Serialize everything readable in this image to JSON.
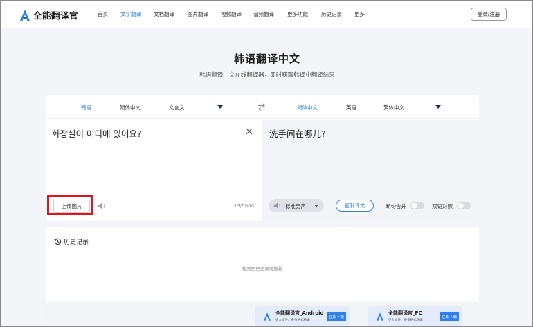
{
  "brand": {
    "name": "全能翻译官"
  },
  "nav": {
    "items": [
      {
        "label": "首页",
        "active": false
      },
      {
        "label": "文字翻译",
        "active": true
      },
      {
        "label": "文档翻译",
        "active": false
      },
      {
        "label": "图片翻译",
        "active": false
      },
      {
        "label": "视频翻译",
        "active": false
      },
      {
        "label": "音频翻译",
        "active": false
      },
      {
        "label": "更多功能",
        "active": false
      },
      {
        "label": "历史记录",
        "active": false
      },
      {
        "label": "更多",
        "active": false
      }
    ],
    "login_label": "登录/注册"
  },
  "hero": {
    "title": "韩语翻译中文",
    "subtitle": "韩语翻译中文在线翻译器，即时获取韩译中翻译结果"
  },
  "translator": {
    "source_langs": [
      "韩语",
      "简体中文",
      "文言文"
    ],
    "target_langs": [
      "简体中文",
      "英语",
      "繁体中文"
    ],
    "source_text": "화장실이 어디에 있어요?",
    "target_text": "洗手间在哪儿?",
    "upload_label": "上传图片",
    "char_count": "13/5000",
    "voice_label": "标准男声",
    "copy_label": "复制译文",
    "toggle_merge_label": "断句合并",
    "toggle_compare_label": "双语对照",
    "toggle_merge_on": false,
    "toggle_compare_on": false
  },
  "history": {
    "title": "历史记录",
    "empty_text": "暂无历史记录可查看"
  },
  "downloads": [
    {
      "name": "全能翻译官_Android",
      "desc": "更大文件、更多格式精编",
      "button": "立即下载"
    },
    {
      "name": "全能翻译官_PC",
      "desc": "更大文件、更多格式精编",
      "button": "立即下载"
    }
  ],
  "colors": {
    "accent": "#2f80ed",
    "highlight": "#e8101b"
  }
}
